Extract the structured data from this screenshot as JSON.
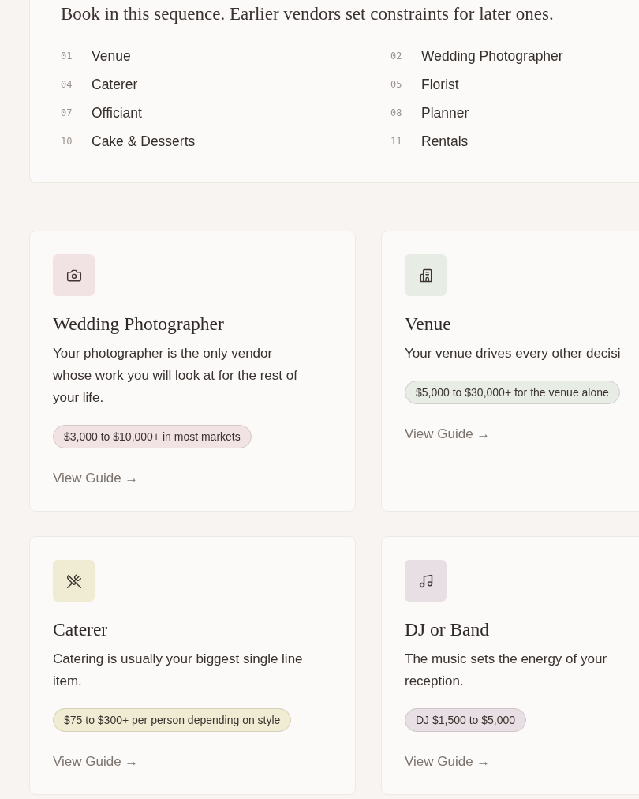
{
  "intro": {
    "text": "Book in this sequence. Earlier vendors set constraints for later ones."
  },
  "sequence": [
    {
      "number": "01",
      "name": "Venue"
    },
    {
      "number": "02",
      "name": "Wedding Photographer"
    },
    {
      "number": "04",
      "name": "Caterer"
    },
    {
      "number": "05",
      "name": "Florist"
    },
    {
      "number": "07",
      "name": "Officiant"
    },
    {
      "number": "08",
      "name": "Planner"
    },
    {
      "number": "10",
      "name": "Cake & Desserts"
    },
    {
      "number": "11",
      "name": "Rentals"
    }
  ],
  "cards": [
    {
      "title": "Wedding Photographer",
      "description": "Your photographer is the only vendor whose work you will look at for the rest of your life.",
      "price": "$3,000 to $10,000+ in most markets",
      "link": "View Guide →",
      "color": "#f1e3e3"
    },
    {
      "title": "Venue",
      "description": "Your venue drives every other decisi",
      "price": "$5,000 to $30,000+ for the venue alone",
      "link": "View Guide →",
      "color": "#e7ece4"
    },
    {
      "title": "Caterer",
      "description": "Catering is usually your biggest single line item.",
      "price": "$75 to $300+ per person depending on style",
      "link": "View Guide →",
      "color": "#f0ebd3"
    },
    {
      "title": "DJ or Band",
      "description": "The music sets the energy of your reception.",
      "price": "DJ $1,500 to $5,000",
      "link": "View Guide →",
      "color": "#e8dfe5"
    }
  ]
}
